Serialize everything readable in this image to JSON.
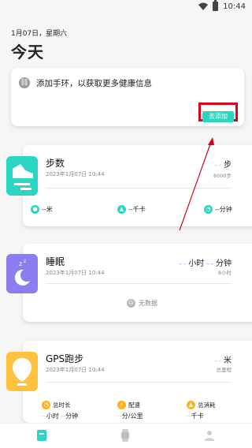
{
  "status_bar": {
    "time": "10:44"
  },
  "header": {
    "date": "1月07日，星期六",
    "title": "今天"
  },
  "add_device": {
    "text": "添加手环，以获取更多健康信息",
    "button": "去添加"
  },
  "steps": {
    "title": "步数",
    "date": "2023年1月07日 10:44",
    "value_dash": "- -",
    "value_unit": "步",
    "goal": "8000步",
    "distance": "--米",
    "calories": "--千卡",
    "duration": "--分钟"
  },
  "sleep": {
    "title": "睡眠",
    "date": "2023年1月07日 10:44",
    "hours_dash": "- -",
    "hours_unit": "小时",
    "minutes_dash": "- -",
    "minutes_unit": "分钟",
    "goal": "8小时",
    "empty": "无数据"
  },
  "gps": {
    "title": "GPS跑步",
    "date": "2023年1月07日 10:44",
    "value_dash": "- -",
    "value_unit": "米",
    "sub": "总里程",
    "stats": [
      {
        "label": "总时长",
        "value_a_dash": "--",
        "value_a_unit": "小时",
        "value_b_dash": "--",
        "value_b_unit": "分钟"
      },
      {
        "label": "配速",
        "value_a_dash": "--",
        "value_a_unit": "分/公里"
      },
      {
        "label": "总消耗",
        "value_a_dash": "--",
        "value_a_unit": "千卡"
      }
    ]
  },
  "colors": {
    "accent": "#2ad6c1",
    "sleep": "#8c7df0",
    "gps": "#ffc23c",
    "highlight": "#e0001a"
  },
  "tabs": [
    {
      "name": "home-tab",
      "icon": "data-card-icon"
    },
    {
      "name": "device-tab",
      "icon": "watch-icon"
    },
    {
      "name": "profile-tab",
      "icon": "person-icon"
    }
  ]
}
